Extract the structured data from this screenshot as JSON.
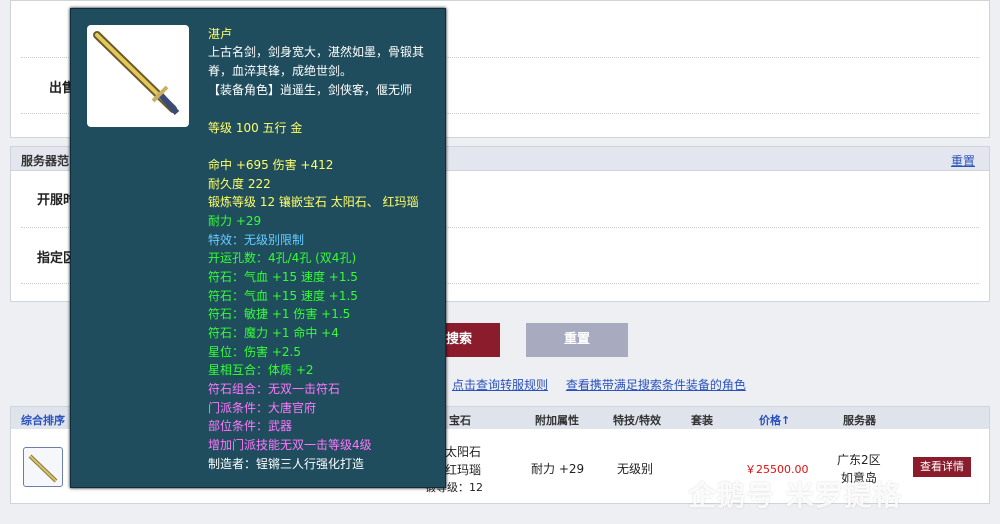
{
  "filters": {
    "sell_label": "出售",
    "server_panel_title": "服务器范",
    "reset_link": "重置",
    "open_label": "开服时",
    "specified_label": "指定区"
  },
  "buttons": {
    "search": "搜索",
    "reset": "重置"
  },
  "links": {
    "transfer_rules": "点击查询转服规则",
    "view_roles": "查看携带满足搜索条件装备的角色"
  },
  "results": {
    "headers": {
      "sort": "综合排序",
      "gem": "宝石",
      "extra_attr": "附加属性",
      "skill": "特技/特效",
      "set": "套装",
      "price": "价格↑",
      "server": "服务器"
    },
    "row": {
      "gem_line1": "太阳石",
      "gem_line2": "红玛瑙",
      "gem_line3": "锻等级：12",
      "extra_attr": "耐力 +29",
      "skill": "无级别",
      "price": "￥25500.00",
      "server_line1": "广东2区",
      "server_line2": "如意岛",
      "detail_button": "查看详情"
    }
  },
  "tooltip": {
    "name": "湛卢",
    "desc1": "上古名剑，剑身宽大，湛然如墨，骨锻其",
    "desc2": "脊，血淬其锋，成绝世剑。",
    "roles": "【装备角色】逍遥生，剑侠客，偃无师",
    "level": "等级 100  五行 金",
    "hit_dmg": "命中 +695  伤害 +412",
    "durability": "耐久度 222",
    "forge": "锻炼等级 12  镶嵌宝石 太阳石、 红玛瑙",
    "stamina": "耐力 +29",
    "effect": "特效：无级别限制",
    "holes": "开运孔数：4孔/4孔 (双4孔)",
    "rune1": "符石：气血 +15  速度 +1.5",
    "rune2": "符石：气血 +15  速度 +1.5",
    "rune3": "符石：敏捷 +1  伤害 +1.5",
    "rune4": "符石：魔力 +1  命中 +4",
    "star": "星位：伤害 +2.5",
    "star_match": "星相互合：体质 +2",
    "rune_combo": "符石组合：无双一击符石",
    "sect_req": "门派条件：大唐官府",
    "part_req": "部位条件：武器",
    "skill_up": "增加门派技能无双一击等级4级",
    "maker": "制造者：锃锵三人行强化打造"
  },
  "watermark": "企鹅号 米罗提格",
  "colors": {
    "tooltip_bg": "#1f4d5e",
    "yellow": "#ffff66",
    "green": "#33ff33",
    "cyan": "#66ccff",
    "purple": "#ff77ff",
    "white": "#ffffff",
    "button_red": "#8a1c2c",
    "price_red": "#e01010"
  }
}
